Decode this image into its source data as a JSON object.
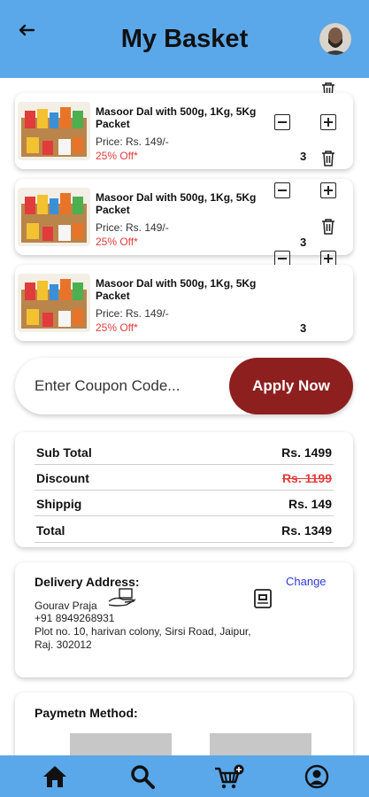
{
  "header": {
    "title": "My Basket",
    "back_icon": "arrow-left-icon",
    "avatar": "user-avatar"
  },
  "cart": {
    "items": [
      {
        "name": "Masoor Dal with 500g, 1Kg, 5Kg Packet",
        "price": "Price: Rs. 149/-",
        "discount": "25% Off*",
        "quantity": "3"
      },
      {
        "name": "Masoor Dal with 500g, 1Kg, 5Kg Packet",
        "price": "Price: Rs. 149/-",
        "discount": "25% Off*",
        "quantity": "3"
      },
      {
        "name": "Masoor Dal with 500g, 1Kg, 5Kg Packet",
        "price": "Price: Rs. 149/-",
        "discount": "25% Off*",
        "quantity": "3"
      }
    ]
  },
  "coupon": {
    "placeholder": "Enter Coupon Code...",
    "apply_label": "Apply Now"
  },
  "summary": {
    "rows": [
      {
        "label": "Sub Total",
        "value": "Rs. 1499"
      },
      {
        "label": "Discount",
        "value": "Rs. 1199"
      },
      {
        "label": "Shippig",
        "value": "Rs. 149"
      },
      {
        "label": "Total",
        "value": "Rs. 1349"
      }
    ]
  },
  "address": {
    "title": "Delivery Address:",
    "change_label": "Change",
    "name": "Gourav Praja",
    "phone": "+91 8949268931",
    "line1": "Plot no. 10, harivan colony, Sirsi Road, Jaipur,",
    "line2": "Raj. 302012"
  },
  "payment": {
    "title": "Paymetn Method:"
  },
  "nav": {
    "items": [
      "home-icon",
      "search-icon",
      "cart-icon",
      "profile-icon"
    ]
  },
  "colors": {
    "header": "#5aa8ea",
    "apply_button": "#8e1f1f",
    "discount_red": "#e23b3b",
    "link_blue": "#2f3bd8"
  }
}
